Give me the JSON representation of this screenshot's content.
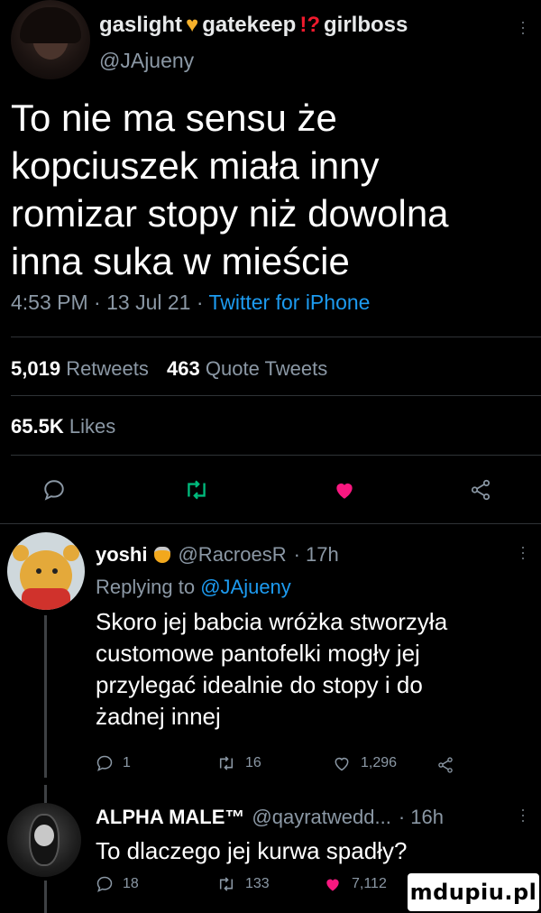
{
  "main_tweet": {
    "display_name": "gaslight",
    "display_name_mid": "gatekeep",
    "display_name_end": "girlboss",
    "handle": "@JAjueny",
    "text_lines": [
      "To nie ma sensu że",
      "kopciuszek miała inny",
      "romizar stopy niż dowolna",
      "inna suka w mieście"
    ],
    "timestamp": "4:53 PM · 13 Jul 21 · ",
    "source": "Twitter for iPhone",
    "retweets_count": "5,019",
    "retweets_label": "Retweets",
    "quotes_count": "463",
    "quotes_label": "Quote Tweets",
    "likes_count": "65.5K",
    "likes_label": "Likes"
  },
  "reply1": {
    "display_name": "yoshi",
    "handle": "@RacroesR",
    "time": "· 17h",
    "replying_prefix": "Replying to ",
    "replying_handle": "@JAjueny",
    "text_lines": [
      "Skoro jej babcia wróżka stworzyła",
      "customowe pantofelki mogły jej",
      "przylegać idealnie do stopy i do",
      "żadnej innej"
    ],
    "replies": "1",
    "retweets": "16",
    "likes": "1,296"
  },
  "reply2": {
    "display_name": "ALPHA MALE™",
    "handle": "@qayratwedd...",
    "time": "· 16h",
    "text": "To dlaczego jej kurwa spadły?",
    "replies": "18",
    "retweets": "133",
    "likes": "7,112"
  },
  "watermark": "mdupiu.pl",
  "colors": {
    "accent": "#1d9bf0",
    "like": "#f91880",
    "retweet": "#00ba7c",
    "bg": "#000000"
  }
}
